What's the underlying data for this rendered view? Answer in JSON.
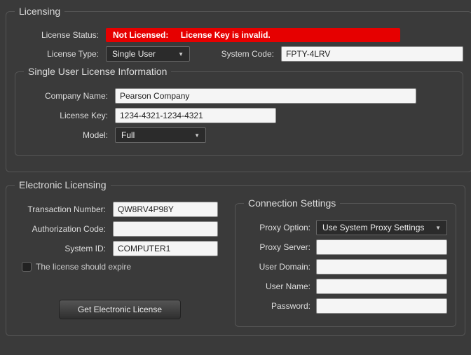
{
  "licensing": {
    "legend": "Licensing",
    "status_label": "License Status:",
    "status_value1": "Not Licensed:",
    "status_value2": "License Key is invalid.",
    "type_label": "License Type:",
    "type_value": "Single User",
    "system_code_label": "System Code:",
    "system_code_value": "FPTY-4LRV"
  },
  "single_user": {
    "legend": "Single User License Information",
    "company_label": "Company Name:",
    "company_value": "Pearson Company",
    "key_label": "License Key:",
    "key_value": "1234-4321-1234-4321",
    "model_label": "Model:",
    "model_value": "Full"
  },
  "electronic": {
    "legend": "Electronic Licensing",
    "transaction_label": "Transaction Number:",
    "transaction_value": "QW8RV4P98Y",
    "auth_label": "Authorization Code:",
    "auth_value": "",
    "system_id_label": "System ID:",
    "system_id_value": "COMPUTER1",
    "expire_label": "The license should expire",
    "button_label": "Get Electronic License"
  },
  "connection": {
    "legend": "Connection Settings",
    "proxy_option_label": "Proxy Option:",
    "proxy_option_value": "Use System Proxy Settings",
    "proxy_server_label": "Proxy Server:",
    "proxy_server_value": "",
    "user_domain_label": "User Domain:",
    "user_domain_value": "",
    "user_name_label": "User Name:",
    "user_name_value": "",
    "password_label": "Password:",
    "password_value": ""
  }
}
